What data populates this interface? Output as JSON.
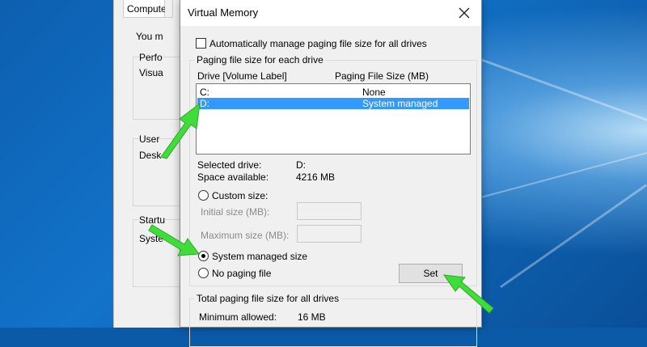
{
  "background_window": {
    "tab_label": "Compute",
    "intro_text": "You m",
    "performance_label": "Perfo",
    "performance_text": "Visua",
    "user_profiles_label": "User",
    "user_profiles_text": "Desk",
    "startup_label": "Startu",
    "startup_text": "Syste"
  },
  "dialog": {
    "title": "Virtual Memory",
    "auto_manage": {
      "label": "Automatically manage paging file size for all drives",
      "checked": false
    },
    "paging_group_label": "Paging file size for each drive",
    "columns": {
      "drive": "Drive  [Volume Label]",
      "size": "Paging File Size (MB)"
    },
    "drives": [
      {
        "drive": "C:",
        "size": "None",
        "selected": false
      },
      {
        "drive": "D:",
        "size": "System managed",
        "selected": true
      }
    ],
    "selected_drive_label": "Selected drive:",
    "selected_drive_value": "D:",
    "space_available_label": "Space available:",
    "space_available_value": "4216 MB",
    "custom_size_label": "Custom size:",
    "initial_size_label": "Initial size (MB):",
    "initial_size_value": "",
    "maximum_size_label": "Maximum size (MB):",
    "maximum_size_value": "",
    "system_managed_label": "System managed size",
    "no_paging_label": "No paging file",
    "selected_option": "system_managed",
    "set_button": "Set",
    "total_group_label": "Total paging file size for all drives",
    "minimum_allowed_label": "Minimum allowed:",
    "minimum_allowed_value": "16 MB"
  },
  "colors": {
    "selection": "#3399ff",
    "annotation_arrow": "#3fdc3a",
    "desktop": "#0a5aa8"
  },
  "icons": {
    "close": "close-icon",
    "annotation": "green-arrow"
  }
}
